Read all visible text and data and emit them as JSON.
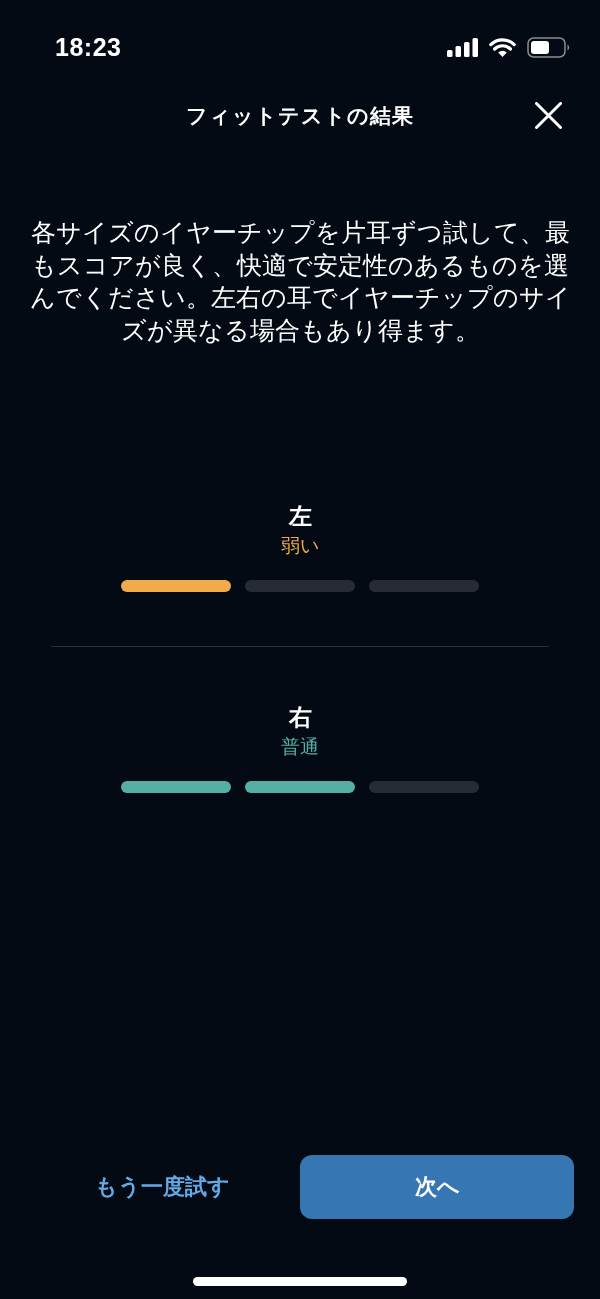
{
  "status_bar": {
    "time": "18:23"
  },
  "header": {
    "title": "フィットテストの結果"
  },
  "instructions": "各サイズのイヤーチップを片耳ずつ試して、最もスコアが良く、快適で安定性のあるものを選んでください。左右の耳でイヤーチップのサイズが異なる場合もあり得ます。",
  "sides": [
    {
      "label": "左",
      "rating": "弱い",
      "color": "#f2aa4a",
      "segments": [
        {
          "filled": true
        },
        {
          "filled": false
        },
        {
          "filled": false
        }
      ]
    },
    {
      "label": "右",
      "rating": "普通",
      "color": "#55afa5",
      "segments": [
        {
          "filled": true
        },
        {
          "filled": true
        },
        {
          "filled": false
        }
      ]
    }
  ],
  "buttons": [
    {
      "kind": "text",
      "label": "もう一度試す"
    },
    {
      "kind": "primary",
      "label": "次へ"
    }
  ]
}
